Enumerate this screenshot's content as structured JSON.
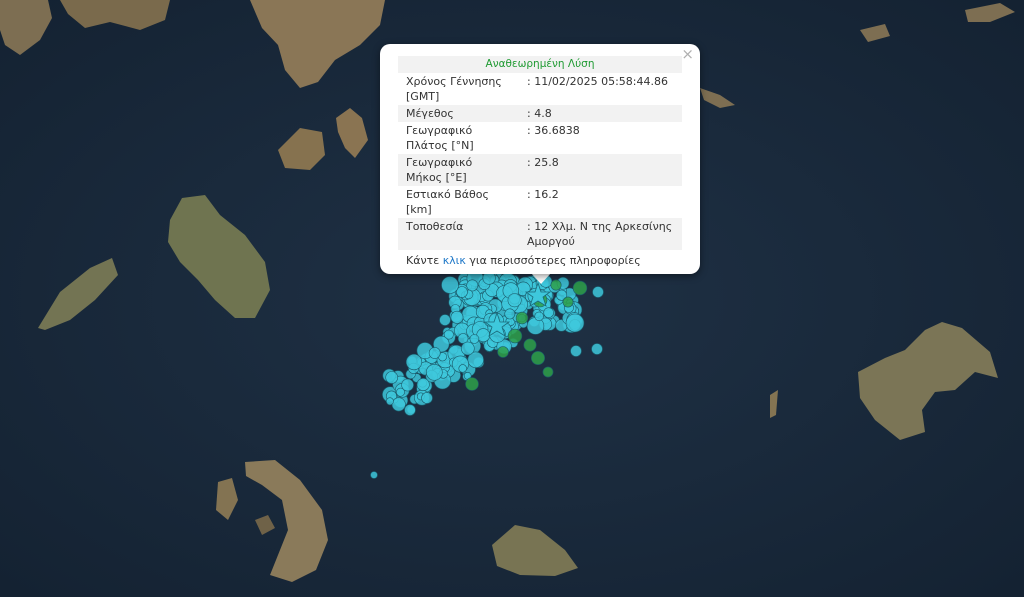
{
  "popup": {
    "title": "Αναθεωρημένη Λύση",
    "close_symbol": "×",
    "rows": [
      {
        "label": "Χρόνος Γέννησης [GMT]",
        "value": ": 11/02/2025 05:58:44.86"
      },
      {
        "label": "Μέγεθος",
        "value": ": 4.8"
      },
      {
        "label": "Γεωγραφικό Πλάτος [°N]",
        "value": ": 36.6838"
      },
      {
        "label": "Γεωγραφικό Μήκος [°E]",
        "value": ": 25.8"
      },
      {
        "label": "Εστιακό Βάθος [km]",
        "value": ": 16.2"
      },
      {
        "label": "Τοποθεσία",
        "value": ": 12 Χλμ. Ν της Αρκεσίνης Αμοργού"
      }
    ],
    "footer_before": "Κάντε",
    "footer_link": "κλικ",
    "footer_after": "για περισσότερες πληροφορίες"
  },
  "colors": {
    "sea": "#1a2a3c",
    "land": "#8a7a5a",
    "recent_quake": "#3ec8dc",
    "older_quake": "#2ea04a",
    "title_green": "#1f9a32",
    "link_blue": "#1f78c8"
  }
}
